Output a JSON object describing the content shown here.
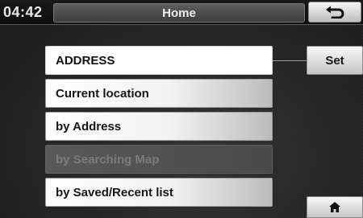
{
  "header": {
    "time": "04:42",
    "title": "Home",
    "back_icon": "return-arrow-icon"
  },
  "menu": {
    "items": [
      {
        "label": "ADDRESS",
        "state": "selected"
      },
      {
        "label": "Current location",
        "state": "normal"
      },
      {
        "label": "by Address",
        "state": "normal"
      },
      {
        "label": "by Searching Map",
        "state": "disabled"
      },
      {
        "label": "by Saved/Recent list",
        "state": "normal"
      }
    ]
  },
  "actions": {
    "set_label": "Set",
    "home_icon": "home-icon"
  },
  "colors": {
    "background": "#262626",
    "button_light": "#f4f4f4",
    "disabled_item": "#595959",
    "text_dark": "#161616"
  }
}
